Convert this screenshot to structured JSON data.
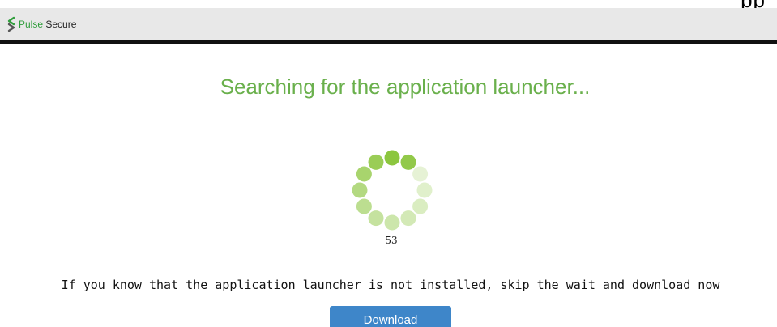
{
  "header": {
    "brand_primary": "Pulse",
    "brand_secondary": "Secure",
    "background_color": "#e8e8e8",
    "logo_icon": "pulse-secure-logo-icon"
  },
  "top_fragment": {
    "text": "pp"
  },
  "main": {
    "title": "Searching for the application launcher...",
    "counter": "53",
    "message": "If you know that the application launcher is not installed, skip the wait and download now",
    "download_label": "Download"
  },
  "colors": {
    "accent_green": "#6ab04c",
    "spinner_green": "#8cc63f",
    "button_blue": "#3e86c9"
  }
}
